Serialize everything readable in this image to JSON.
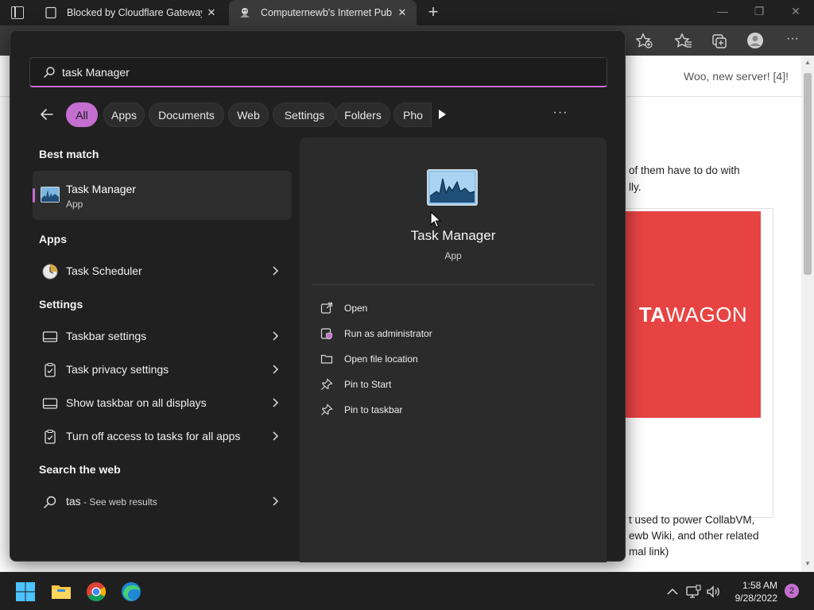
{
  "browser": {
    "tabs": [
      {
        "label": "Blocked by Cloudflare Gateway",
        "close": "✕"
      },
      {
        "label": "Computernewb's Internet Pub Hub",
        "close": "✕"
      }
    ],
    "new_tab": "+"
  },
  "page": {
    "header_news": "Woo, new server! [4]!",
    "text_line_1": "of them have to do with",
    "text_line_2": "lly.",
    "banner_text_bold": "TA",
    "banner_text_light": "WAGON",
    "text_line_3": "t used to power CollabVM,",
    "text_line_4": "ewb Wiki, and other related",
    "text_line_5": "mal link)"
  },
  "search": {
    "query": "task Manager"
  },
  "filters": [
    "All",
    "Apps",
    "Documents",
    "Web",
    "Settings",
    "Folders",
    "Pho"
  ],
  "more_label": "···",
  "sections": {
    "best_match": "Best match",
    "apps": "Apps",
    "settings": "Settings",
    "search_web": "Search the web"
  },
  "best_match": {
    "name": "Task Manager",
    "type": "App"
  },
  "apps": [
    {
      "label": "Task Scheduler"
    }
  ],
  "settings": [
    {
      "label": "Taskbar settings"
    },
    {
      "label": "Task privacy settings"
    },
    {
      "label": "Show taskbar on all displays"
    },
    {
      "label": "Turn off access to tasks for all apps"
    }
  ],
  "web": {
    "query": "tas",
    "suffix": " - See web results"
  },
  "preview": {
    "name": "Task Manager",
    "type": "App",
    "actions": [
      "Open",
      "Run as administrator",
      "Open file location",
      "Pin to Start",
      "Pin to taskbar"
    ]
  },
  "taskbar": {
    "time": "1:58 AM",
    "date": "9/28/2022",
    "notifications": "2"
  },
  "colors": {
    "accent": "#c46fd0",
    "flyout_bg": "#202020",
    "pane_bg": "#2b2b2b",
    "banner": "#e84343"
  }
}
